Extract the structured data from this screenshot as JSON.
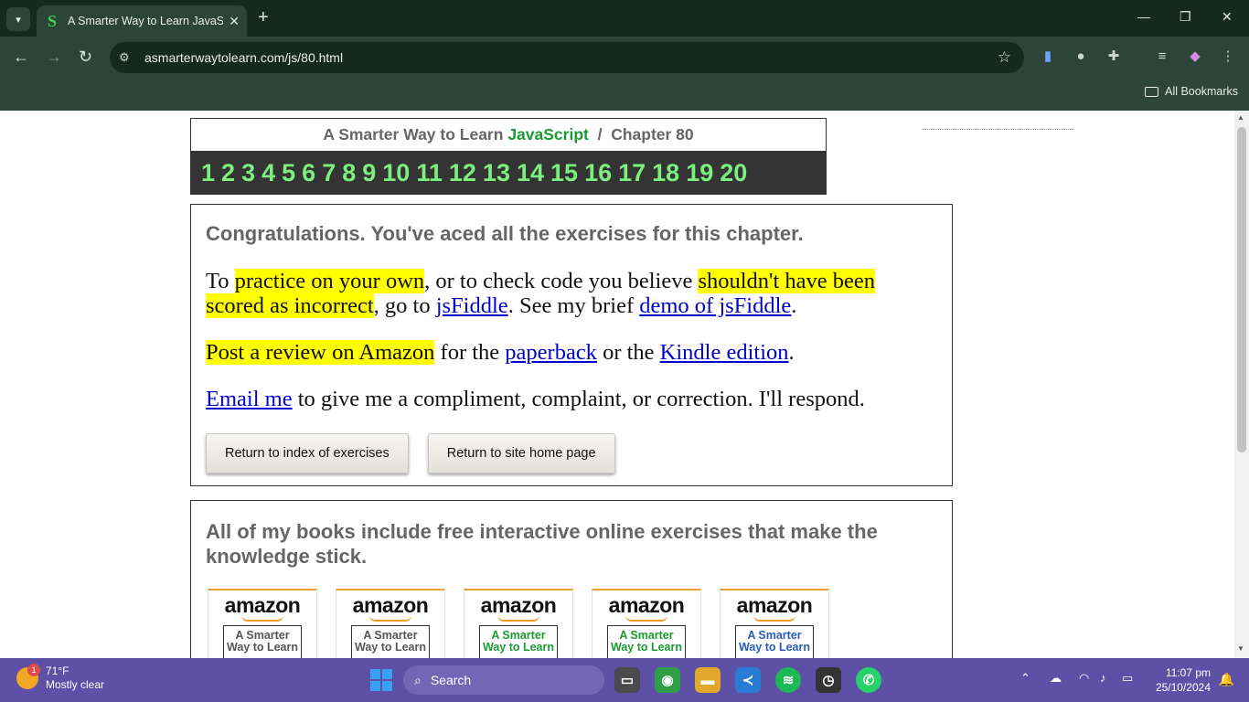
{
  "browser": {
    "tab_title": "A Smarter Way to Learn JavaScript",
    "tab_favicon": "S",
    "url": "asmarterwaytolearn.com/js/80.html",
    "bookmarks_label": "All Bookmarks"
  },
  "header": {
    "prefix": "A Smarter Way to Learn",
    "brand": "JavaScript",
    "sep": "/",
    "chapter": "Chapter 80",
    "nav_numbers": [
      "1",
      "2",
      "3",
      "4",
      "5",
      "6",
      "7",
      "8",
      "9",
      "10",
      "11",
      "12",
      "13",
      "14",
      "15",
      "16",
      "17",
      "18",
      "19",
      "20"
    ]
  },
  "congrats": {
    "heading": "Congratulations. You've aced all the exercises for this chapter.",
    "p1_a": "To ",
    "p1_hl1": "practice on your own",
    "p1_b": ", or to check code you believe ",
    "p1_hl2": "shouldn't have been scored as incorrect",
    "p1_c": ", go to ",
    "p1_link1": "jsFiddle",
    "p1_d": ". See my brief ",
    "p1_link2": "demo of jsFiddle",
    "p1_e": ".",
    "p2_hl": "Post a review on Amazon",
    "p2_a": " for the ",
    "p2_link1": "paperback",
    "p2_b": " or the ",
    "p2_link2": "Kindle edition",
    "p2_c": ".",
    "p3_link": "Email me",
    "p3_a": " to give me a compliment, complaint, or correction. I'll respond.",
    "btn_index": "Return to index of exercises",
    "btn_home": "Return to site home page"
  },
  "books": {
    "heading": "All of my books include free interactive online exercises that make the knowledge stick.",
    "amazon_label": "amazon",
    "covers": [
      {
        "title": "A Smarter Way to Learn",
        "color": "#555555"
      },
      {
        "title": "A Smarter Way to Learn",
        "color": "#555555"
      },
      {
        "title": "A Smarter Way to Learn",
        "color": "#1a9a32"
      },
      {
        "title": "A Smarter Way to Learn",
        "color": "#1a9a32"
      },
      {
        "title": "A Smarter Way to Learn",
        "color": "#2a5db0"
      }
    ]
  },
  "taskbar": {
    "temperature": "71°F",
    "weather": "Mostly clear",
    "weather_badge": "1",
    "search_label": "Search",
    "time": "11:07 pm",
    "date": "25/10/2024"
  }
}
